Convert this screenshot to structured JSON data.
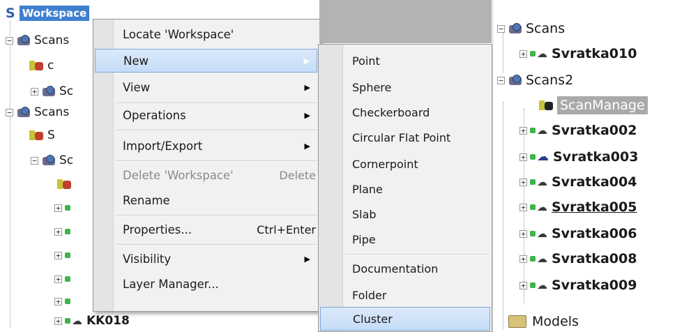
{
  "left_tree": {
    "workspace_letter": "S",
    "workspace_label": "Workspace",
    "rows": [
      {
        "label": "Scans"
      },
      {
        "label": "c"
      },
      {
        "label": "Sc"
      },
      {
        "label": "Scans"
      },
      {
        "label": "S"
      },
      {
        "label": "Sc"
      },
      {
        "label": "KK018"
      }
    ]
  },
  "context_menu": {
    "items": [
      {
        "label": "Locate 'Workspace'"
      },
      {
        "label": "New",
        "submenu": true
      },
      {
        "label": "View",
        "submenu": true
      },
      {
        "label": "Operations",
        "submenu": true
      },
      {
        "label": "Import/Export",
        "submenu": true
      },
      {
        "label": "Delete 'Workspace'",
        "shortcut": "Delete"
      },
      {
        "label": "Rename"
      },
      {
        "label": "Properties...",
        "shortcut": "Ctrl+Enter"
      },
      {
        "label": "Visibility",
        "submenu": true
      },
      {
        "label": "Layer Manager..."
      }
    ]
  },
  "new_submenu": {
    "items": [
      {
        "label": "Point"
      },
      {
        "label": "Sphere"
      },
      {
        "label": "Checkerboard"
      },
      {
        "label": "Circular Flat Point"
      },
      {
        "label": "Cornerpoint"
      },
      {
        "label": "Plane"
      },
      {
        "label": "Slab"
      },
      {
        "label": "Pipe"
      },
      {
        "label": "Documentation"
      },
      {
        "label": "Folder"
      },
      {
        "label": "Cluster"
      }
    ]
  },
  "right_tree": {
    "rows": [
      {
        "label": "Scans"
      },
      {
        "label": "Svratka010"
      },
      {
        "label": "Scans2"
      },
      {
        "label": "ScanManage"
      },
      {
        "label": "Svratka002"
      },
      {
        "label": "Svratka003"
      },
      {
        "label": "Svratka004"
      },
      {
        "label": "Svratka005"
      },
      {
        "label": "Svratka006"
      },
      {
        "label": "Svratka008"
      },
      {
        "label": "Svratka009"
      },
      {
        "label": "Models"
      }
    ]
  },
  "icons": {
    "scan_group": "scanner-icon",
    "scan_manager": "scan-manager-icon",
    "cloud": "point-cloud-icon",
    "folder": "folder-icon"
  },
  "colors": {
    "selection_blue": "#3f7fd0",
    "menu_highlight": "#c5dcf7",
    "selected_gray": "#a9a9a9",
    "status_green": "#3fb44a"
  }
}
